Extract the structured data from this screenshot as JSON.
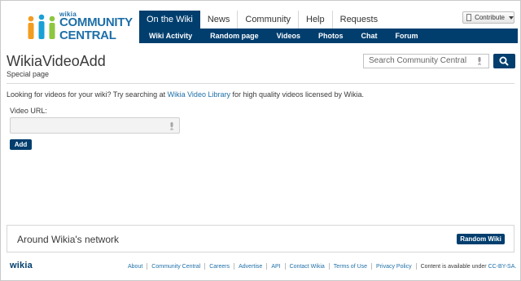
{
  "brand": {
    "small": "wikia",
    "line1": "COMMUNITY",
    "line2": "CENTRAL",
    "colors": {
      "navy": "#013e6e",
      "blue": "#1e6fa8",
      "orange": "#f39c1f",
      "green": "#8dc63f",
      "teal": "#1aa0d4"
    }
  },
  "topnav": {
    "tabs": [
      {
        "label": "On the Wiki",
        "active": true
      },
      {
        "label": "News"
      },
      {
        "label": "Community"
      },
      {
        "label": "Help"
      },
      {
        "label": "Requests"
      }
    ],
    "subnav": [
      "Wiki Activity",
      "Random page",
      "Videos",
      "Photos",
      "Chat",
      "Forum"
    ]
  },
  "contribute": {
    "label": "Contribute",
    "icon": "document-icon"
  },
  "page": {
    "title": "WikiaVideoAdd",
    "subtitle": "Special page"
  },
  "search": {
    "placeholder": "Search Community Central",
    "mic_icon": "microphone-icon",
    "button_icon": "magnifier-icon"
  },
  "content": {
    "intro_before": "Looking for videos for your wiki? Try searching at ",
    "intro_link": "Wikia Video Library",
    "intro_after": " for high quality videos licensed by Wikia.",
    "url_label": "Video URL:",
    "url_value": "",
    "add_label": "Add"
  },
  "network": {
    "title": "Around Wikia's network",
    "button": "Random Wiki"
  },
  "footer": {
    "logo": "wikia",
    "links": [
      "About",
      "Community Central",
      "Careers",
      "Advertise",
      "API",
      "Contact Wikia",
      "Terms of Use",
      "Privacy Policy"
    ],
    "license_text": "Content is available under ",
    "license_link": "CC-BY-SA."
  }
}
